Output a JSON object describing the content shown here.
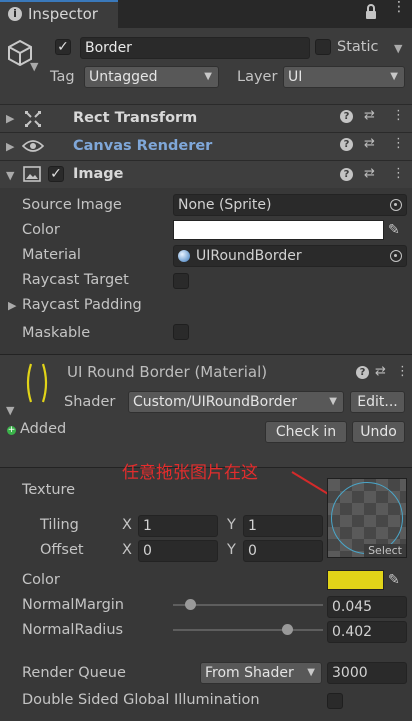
{
  "tab": {
    "title": "Inspector",
    "lock_icon": "lock-icon",
    "menu_icon": "kebab-icon"
  },
  "object": {
    "name": "Border",
    "static_label": "Static",
    "tag_label": "Tag",
    "tag_value": "Untagged",
    "layer_label": "Layer",
    "layer_value": "UI"
  },
  "components": {
    "rect_transform": "Rect Transform",
    "canvas_renderer": "Canvas Renderer",
    "image": "Image"
  },
  "image": {
    "source_image_label": "Source Image",
    "source_image_value": "None (Sprite)",
    "color_label": "Color",
    "color_value": "#ffffff",
    "material_label": "Material",
    "material_value": "UIRoundBorder",
    "raycast_target_label": "Raycast Target",
    "raycast_padding_label": "Raycast Padding",
    "maskable_label": "Maskable"
  },
  "material": {
    "title": "UI Round Border (Material)",
    "shader_label": "Shader",
    "shader_value": "Custom/UIRoundBorder",
    "edit_button": "Edit...",
    "added_label": "Added",
    "checkin_button": "Check in",
    "undo_button": "Undo",
    "annotation": "任意拖张图片在这",
    "texture_label": "Texture",
    "tiling_label": "Tiling",
    "offset_label": "Offset",
    "x_label": "X",
    "y_label": "Y",
    "tiling_x": "1",
    "tiling_y": "1",
    "offset_x": "0",
    "offset_y": "0",
    "select_label": "Select",
    "color_label": "Color",
    "color_value": "#e1d418",
    "normal_margin_label": "NormalMargin",
    "normal_margin_value": "0.045",
    "normal_margin_fraction": 0.09,
    "normal_radius_label": "NormalRadius",
    "normal_radius_value": "0.402",
    "normal_radius_fraction": 0.8,
    "render_queue_label": "Render Queue",
    "render_queue_mode": "From Shader",
    "render_queue_value": "3000",
    "double_sided_label": "Double Sided Global Illumination"
  }
}
